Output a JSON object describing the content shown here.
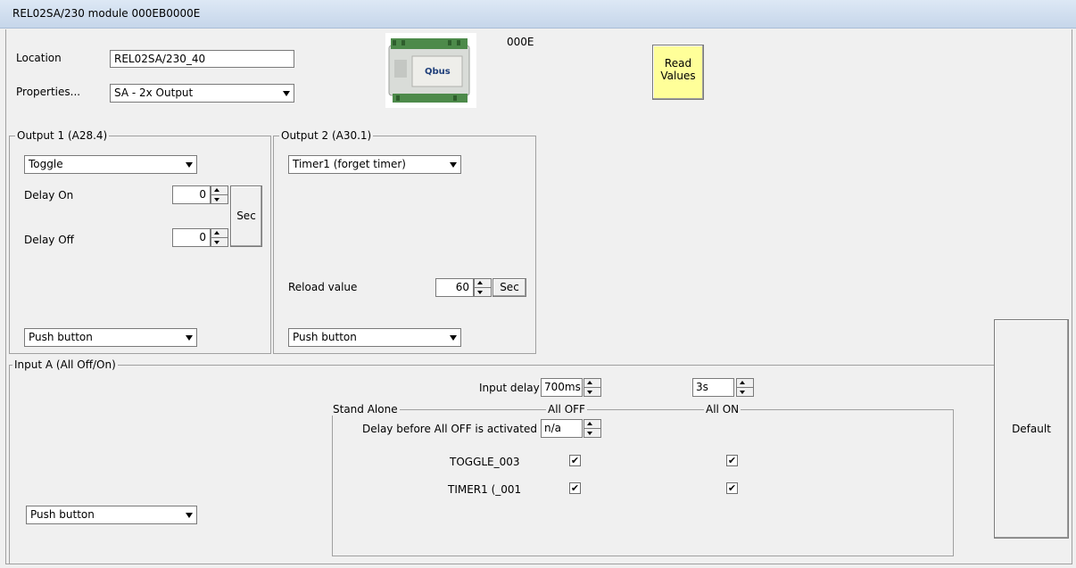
{
  "window": {
    "title": "REL02SA/230 module 000EB0000E"
  },
  "module": {
    "location_label": "Location",
    "location_value": "REL02SA/230_40",
    "properties_label": "Properties...",
    "properties_value": "SA - 2x Output",
    "image_text": "Qbus",
    "address": "000E",
    "read_values_label": "Read\nValues"
  },
  "output1": {
    "title": "Output 1 (A28.4)",
    "mode": "Toggle",
    "delay_on_label": "Delay On",
    "delay_on_value": "0",
    "delay_off_label": "Delay Off",
    "delay_off_value": "0",
    "sec_label": "Sec",
    "input_type": "Push button"
  },
  "output2": {
    "title": "Output 2 (A30.1)",
    "mode": "Timer1 (forget timer)",
    "reload_label": "Reload value",
    "reload_value": "60",
    "sec_label": "Sec",
    "input_type": "Push button"
  },
  "input_a": {
    "title": "Input A (All Off/On)",
    "input_delay_label": "Input delay",
    "input_delay_value": "700ms",
    "second_delay_value": "3s",
    "input_type": "Push button",
    "default_label": "Default"
  },
  "stand_alone": {
    "title": "Stand Alone",
    "all_off_header": "All OFF",
    "all_on_header": "All ON",
    "delay_all_off_label": "Delay before All OFF is activated",
    "delay_all_off_value": "n/a",
    "rows": [
      {
        "name": "TOGGLE_003",
        "all_off": true,
        "all_on": true
      },
      {
        "name": "TIMER1 (_001",
        "all_off": true,
        "all_on": true
      }
    ]
  },
  "check_mark": "✔"
}
